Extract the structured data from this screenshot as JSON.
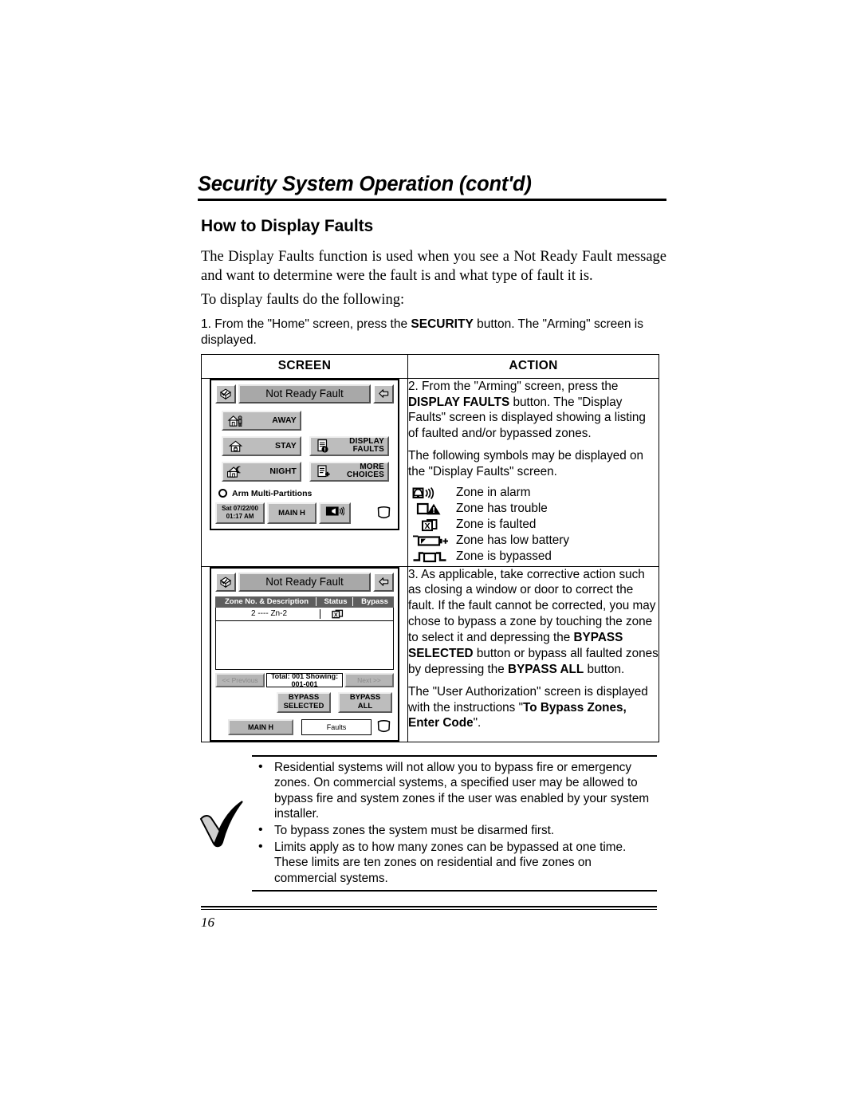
{
  "runhead": {
    "title": "Security System Operation (cont'd)"
  },
  "section": {
    "heading": "How to Display Faults"
  },
  "intro": {
    "p1": "The Display Faults function is used when you see a Not Ready Fault message and want to determine were the fault is and what type of fault it is.",
    "p2": "To display faults do the following:",
    "step1_a": "1.   From the \"Home\" screen, press the ",
    "step1_bold": "SECURITY",
    "step1_b": " button.  The \"Arming\" screen is displayed."
  },
  "table": {
    "headers": {
      "screen": "SCREEN",
      "action": "ACTION"
    }
  },
  "arming_screen": {
    "title": "Not Ready Fault",
    "home_icon": "home-box-icon",
    "back_icon": "back-arrow-icon",
    "buttons": [
      {
        "label": "AWAY",
        "icon": "house-person-icon"
      },
      {
        "label_line1": "DISPLAY",
        "label_line2": "FAULTS",
        "icon": "document-alert-icon"
      },
      {
        "label": "STAY",
        "icon": "house-lock-icon"
      },
      {
        "label_line1": "MORE",
        "label_line2": "CHOICES",
        "icon": "document-plus-icon"
      },
      {
        "label": "NIGHT",
        "icon": "house-moon-icon"
      }
    ],
    "multi_partition_label": "Arm Multi-Partitions",
    "status": {
      "date": "Sat 07/22/00",
      "time": "01:17 AM",
      "main_button": "MAIN H",
      "volume_icon": "speaker-volume-icon",
      "logo_icon": "shield-logo-icon"
    }
  },
  "faults_screen": {
    "title": "Not Ready Fault",
    "home_icon": "home-box-icon",
    "back_icon": "back-arrow-icon",
    "columns": [
      "Zone No. & Description",
      "Status",
      "Bypass"
    ],
    "rows": [
      {
        "zone": "2 ---- Zn-2",
        "status_icon": "zone-faulted-icon",
        "bypass": ""
      }
    ],
    "pager": {
      "previous": "<< Previous",
      "total": "Total: 001  Showing: 001-001",
      "next": "Next >>"
    },
    "bypass_selected": {
      "line1": "BYPASS",
      "line2": "SELECTED"
    },
    "bypass_all": {
      "line1": "BYPASS",
      "line2": "ALL"
    },
    "bottom": {
      "main_button": "MAIN H",
      "faults_button": "Faults",
      "logo_icon": "shield-logo-icon"
    }
  },
  "action_row1": {
    "p1_a": "2.  From the \"Arming\" screen, press the ",
    "p1_bold": "DISPLAY FAULTS",
    "p1_b": " button.  The \"Display Faults\" screen is displayed showing a listing of faulted and/or bypassed zones.",
    "p2": "The following symbols may be displayed on the \"Display Faults\" screen.",
    "symbols": [
      {
        "icon": "zone-in-alarm-icon",
        "label": "Zone in alarm"
      },
      {
        "icon": "zone-trouble-icon",
        "label": "Zone has trouble"
      },
      {
        "icon": "zone-faulted-icon",
        "label": "Zone is faulted"
      },
      {
        "icon": "zone-low-battery-icon",
        "label": "Zone has low battery"
      },
      {
        "icon": "zone-bypassed-icon",
        "label": "Zone is bypassed"
      }
    ]
  },
  "action_row2": {
    "p1_a": "3.  As applicable, take corrective action such as closing a window or door to correct the fault. If the fault cannot be corrected, you may chose to bypass a zone by touching the zone to select it and depressing the ",
    "p1_bold1": "BYPASS SELECTED",
    "p1_b": " button or bypass all faulted zones by depressing the ",
    "p1_bold2": "BYPASS ALL",
    "p1_c": " button.",
    "p2_a": "The \"User Authorization\" screen is displayed with the instructions \"",
    "p2_bold": "To Bypass Zones, Enter Code",
    "p2_b": "\"."
  },
  "notes": {
    "icon": "checkmark-icon",
    "items": [
      "Residential systems will not allow you to bypass fire or emergency zones. On commercial systems, a specified user may be allowed to bypass fire and system zones if the user was enabled by your system installer.",
      "To bypass zones the system must be disarmed first.",
      "Limits apply as to how many zones can be bypassed at one time. These limits are ten zones on residential and five zones on commercial systems."
    ]
  },
  "footer": {
    "page_number": "16"
  }
}
